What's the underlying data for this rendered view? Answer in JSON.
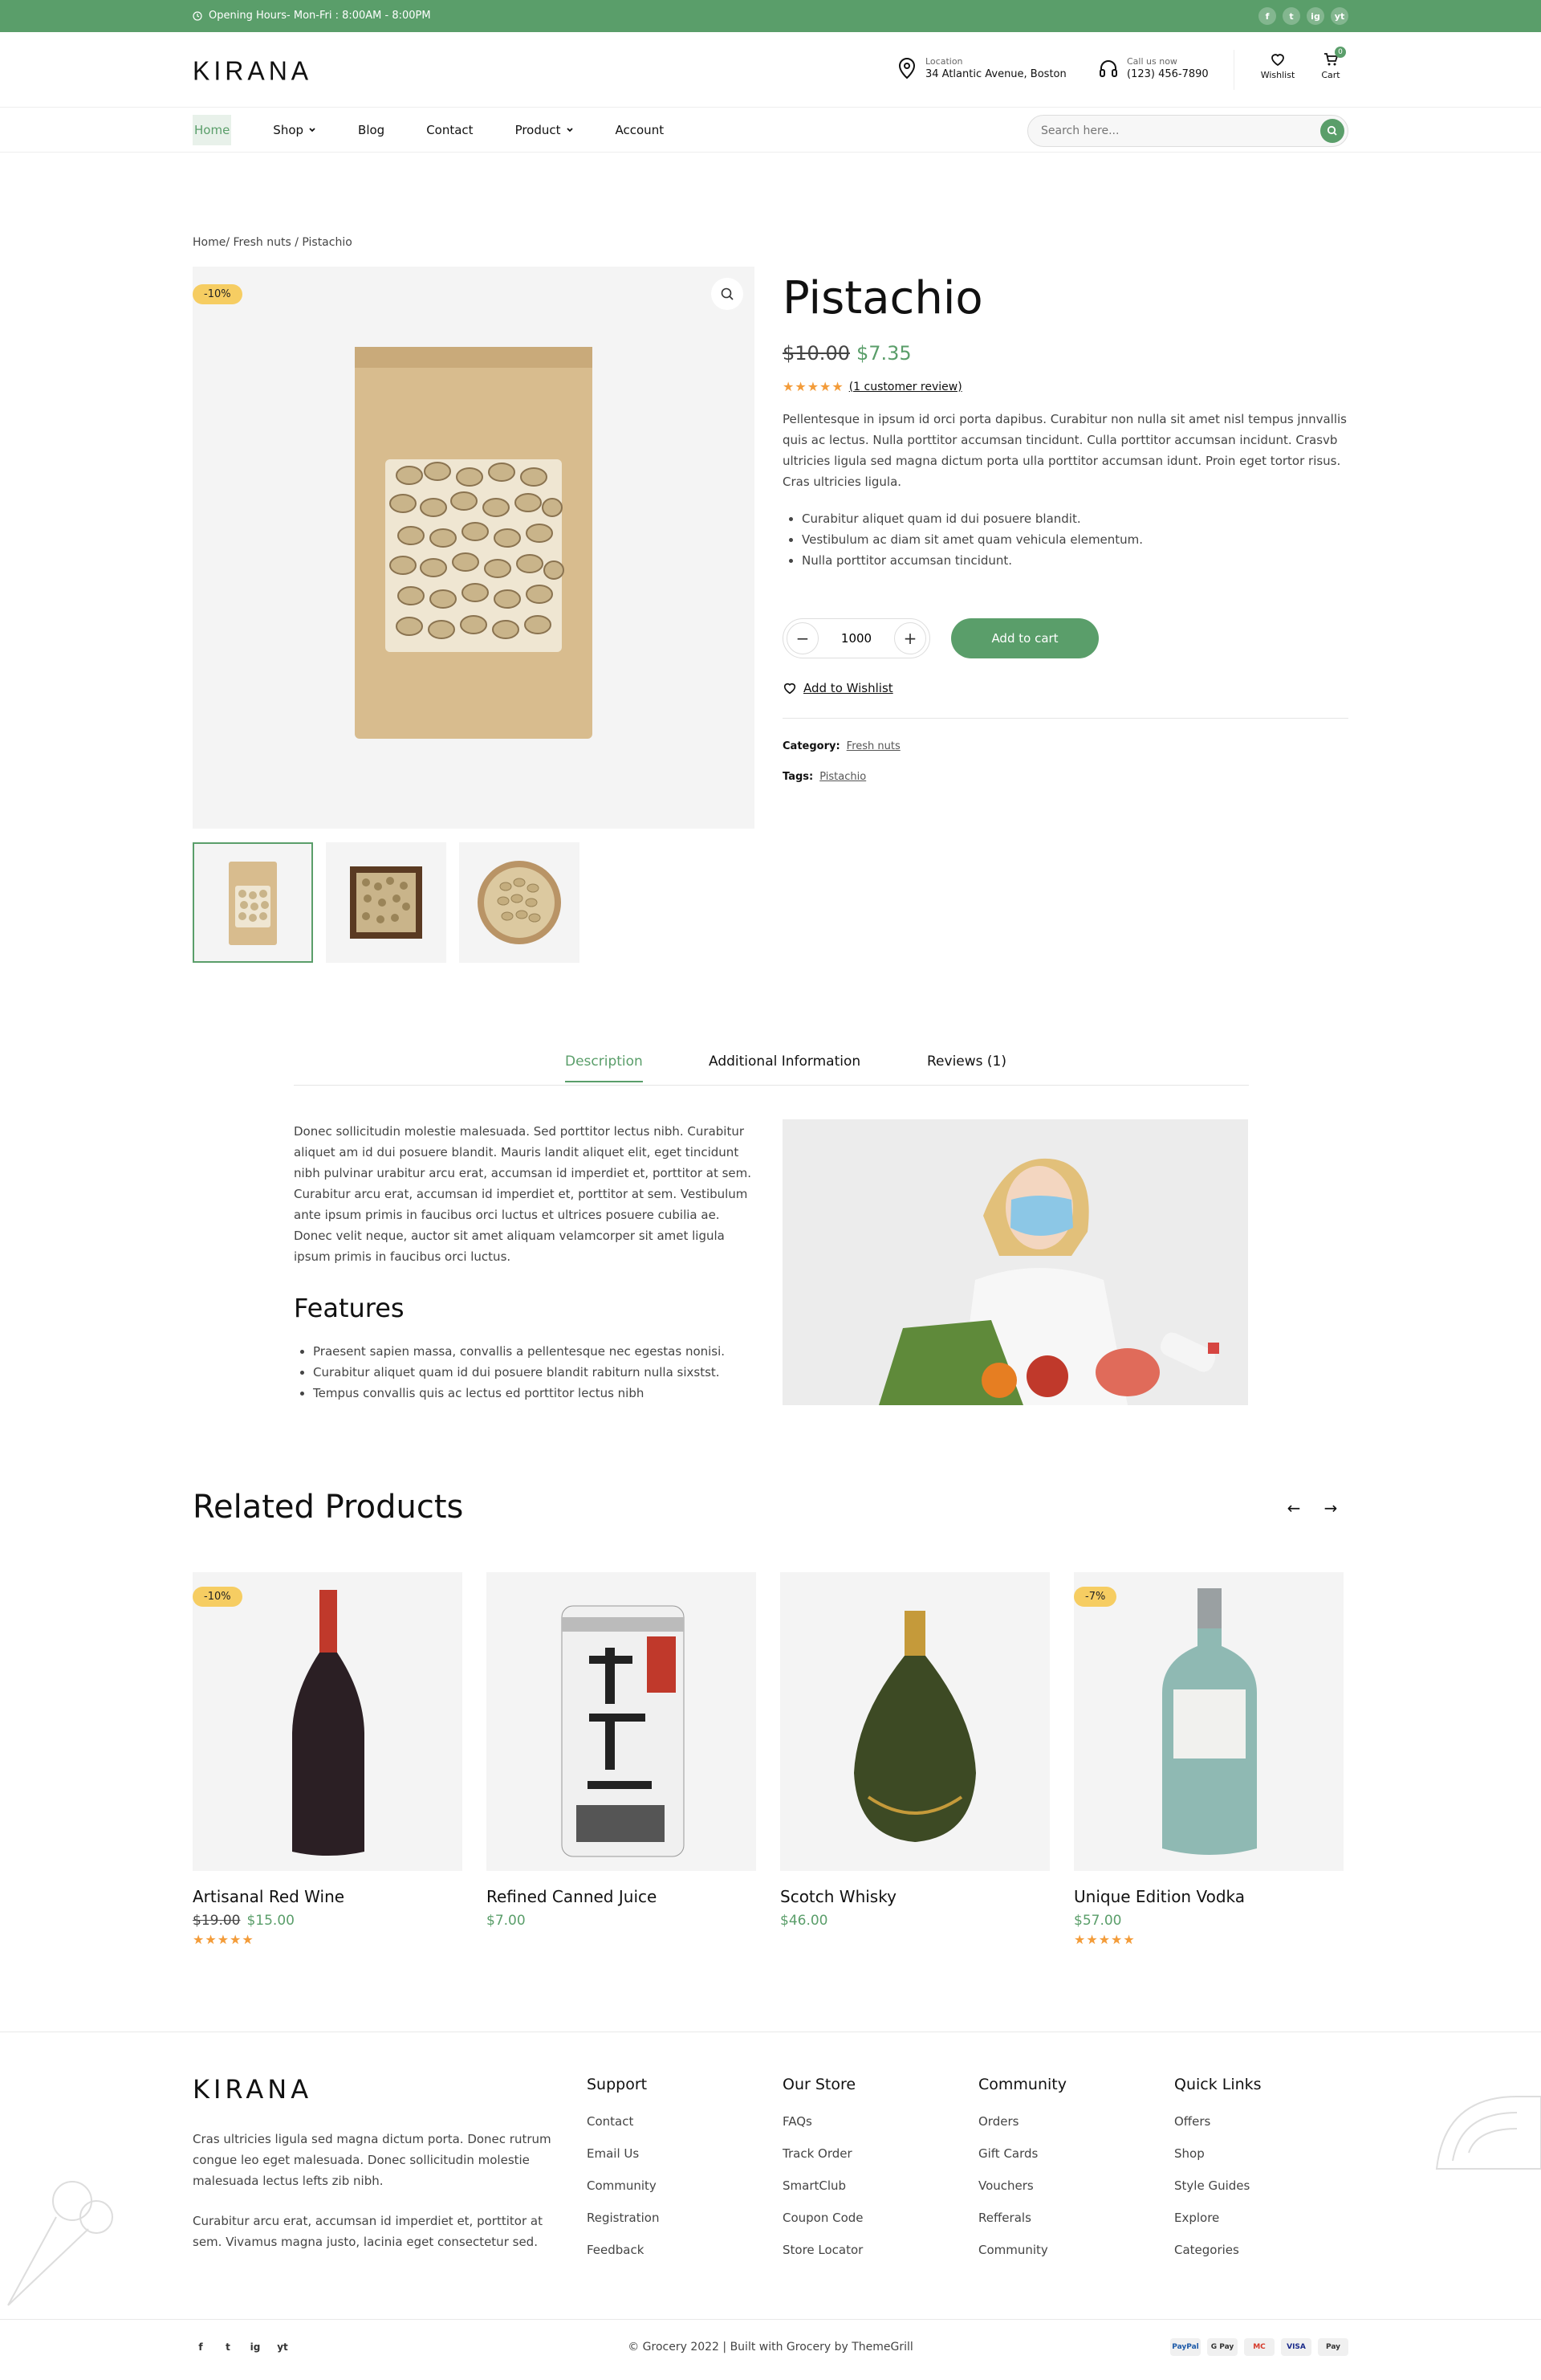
{
  "topbar": {
    "hours": "Opening Hours- Mon-Fri : 8:00AM - 8:00PM",
    "social": [
      "f",
      "t",
      "ig",
      "yt"
    ]
  },
  "header": {
    "logo": "KIRANA",
    "location_label": "Location",
    "location_value": "34 Atlantic Avenue, Boston",
    "call_label": "Call us now",
    "call_value": "(123) 456-7890",
    "wishlist_label": "Wishlist",
    "cart_label": "Cart",
    "cart_count": "0"
  },
  "nav": {
    "items": [
      "Home",
      "Shop",
      "Blog",
      "Contact",
      "Product",
      "Account"
    ],
    "search_placeholder": "Search here..."
  },
  "breadcrumb": "Home/ Fresh nuts / Pistachio",
  "product": {
    "sale_badge": "-10%",
    "title": "Pistachio",
    "old_price": "$10.00",
    "new_price": "$7.35",
    "stars": "★★★★★",
    "rating": 5,
    "review_link": "(1 customer review)",
    "description": "Pellentesque in ipsum id orci porta dapibus. Curabitur non nulla sit amet nisl tempus jnnvallis quis ac lectus. Nulla porttitor accumsan tincidunt. Culla porttitor accumsan incidunt. Crasvb ultricies ligula sed magna dictum porta ulla porttitor accumsan idunt. Proin eget tortor risus. Cras ultricies ligula.",
    "bullets": [
      "Curabitur aliquet quam id dui posuere blandit.",
      "Vestibulum ac diam sit amet quam vehicula elementum.",
      "Nulla porttitor accumsan tincidunt."
    ],
    "quantity": "1000",
    "add_to_cart": "Add to cart",
    "add_to_wishlist": "Add to Wishlist",
    "category_label": "Category:",
    "category_value": "Fresh nuts",
    "tags_label": "Tags:",
    "tags_value": "Pistachio"
  },
  "tabs": {
    "items": [
      "Description",
      "Additional Information",
      "Reviews (1)"
    ],
    "active": "Description",
    "description_text": "Donec sollicitudin molestie malesuada. Sed porttitor lectus nibh. Curabitur aliquet am id dui posuere blandit. Mauris landit aliquet elit, eget tincidunt nibh pulvinar urabitur arcu erat, accumsan id imperdiet et, porttitor at sem. Curabitur arcu erat, accumsan id imperdiet et, porttitor at sem. Vestibulum ante ipsum primis in faucibus orci luctus et ultrices posuere cubilia ae. Donec velit neque, auctor sit amet aliquam velamcorper sit amet ligula ipsum primis in faucibus orci luctus.",
    "features_heading": "Features",
    "features": [
      "Praesent sapien massa, convallis a pellentesque nec egestas nonisi.",
      "Curabitur aliquet quam id dui posuere blandit rabiturn nulla sixstst.",
      "Tempus convallis quis ac lectus ed porttitor lectus nibh"
    ]
  },
  "related": {
    "heading": "Related Products",
    "products": [
      {
        "name": "Artisanal Red Wine",
        "old_price": "$19.00",
        "price": "$15.00",
        "badge": "-10%",
        "stars": "★★★★★"
      },
      {
        "name": "Refined Canned Juice",
        "old_price": "",
        "price": "$7.00",
        "badge": "",
        "stars": ""
      },
      {
        "name": "Scotch Whisky",
        "old_price": "",
        "price": "$46.00",
        "badge": "",
        "stars": ""
      },
      {
        "name": "Unique Edition Vodka",
        "old_price": "",
        "price": "$57.00",
        "badge": "-7%",
        "stars": "★★★★★"
      }
    ]
  },
  "footer": {
    "logo": "KIRANA",
    "desc1": "Cras ultricies ligula sed magna dictum porta. Donec rutrum congue leo eget malesuada. Donec sollicitudin molestie malesuada lectus lefts zib nibh.",
    "desc2": "Curabitur arcu erat, accumsan id imperdiet et, porttitor at sem. Vivamus magna justo, lacinia eget consectetur sed.",
    "columns": [
      {
        "title": "Support",
        "links": [
          "Contact",
          "Email Us",
          "Community",
          "Registration",
          "Feedback"
        ]
      },
      {
        "title": "Our Store",
        "links": [
          "FAQs",
          "Track Order",
          "SmartClub",
          "Coupon Code",
          "Store Locator"
        ]
      },
      {
        "title": "Community",
        "links": [
          "Orders",
          "Gift Cards",
          "Vouchers",
          "Refferals",
          "Community"
        ]
      },
      {
        "title": "Quick Links",
        "links": [
          "Offers",
          "Shop",
          "Style Guides",
          "Explore",
          "Categories"
        ]
      }
    ],
    "copyright": "© Grocery 2022 | Built with Grocery by ThemeGrill",
    "payments": [
      "PayPal",
      "G Pay",
      "MC",
      "VISA",
      "Pay"
    ]
  },
  "colors": {
    "accent": "#5a9e6a",
    "badge": "#f6cd62",
    "stars": "#f39c3a"
  }
}
